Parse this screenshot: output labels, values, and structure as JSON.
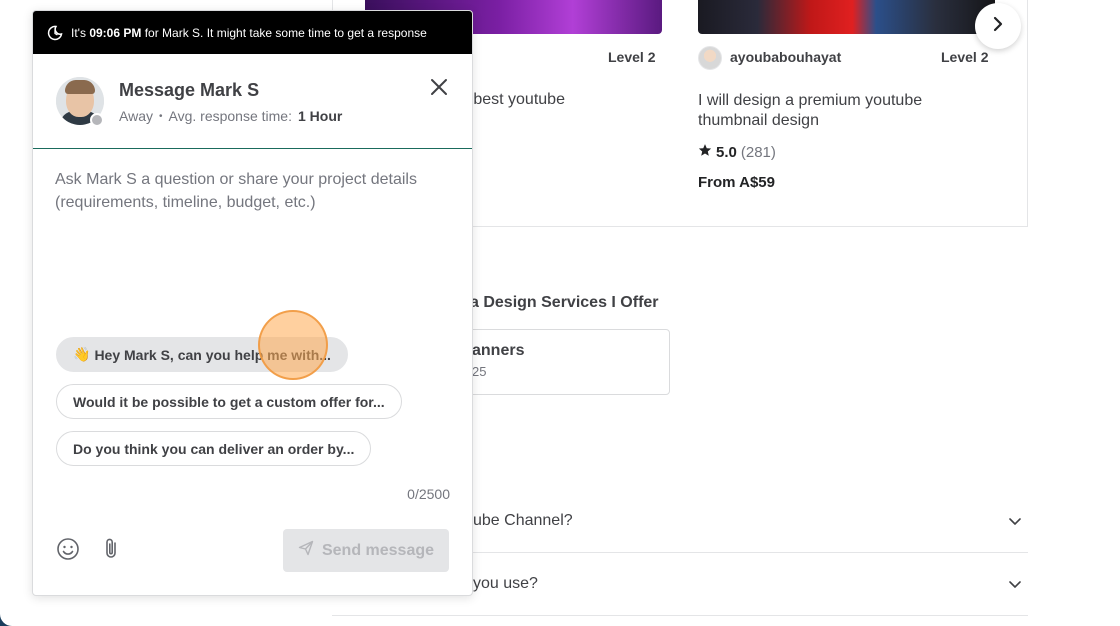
{
  "banner": {
    "prefix": "It's",
    "time": "09:06 PM",
    "suffix": "for Mark S. It might take some time to get a response"
  },
  "chat": {
    "title": "Message Mark S",
    "status": "Away",
    "avg_label": "Avg. response time:",
    "avg_value": "1 Hour",
    "input_placeholder": "Ask Mark S a question or share your project details (requirements, timeline, budget, etc.)",
    "input_value": "",
    "suggestions": [
      {
        "emoji": "👋",
        "label": "Hey Mark S, can you help me with..."
      },
      {
        "label": "Would it be possible to get a custom offer for..."
      },
      {
        "label": "Do you think you can deliver an order by..."
      }
    ],
    "counter": "0/2500",
    "send_label": "Send message"
  },
  "background": {
    "card1": {
      "level": "Level 2",
      "title_fragment": "e best youtube",
      "seller_fragment": ")"
    },
    "card2": {
      "seller": "ayoubabouhayat",
      "level": "Level 2",
      "title": "I will design a premium youtube thumbnail design",
      "rating": "5.0",
      "rating_count": "(281)",
      "price": "From A$59"
    },
    "services_heading": "a Design Services I Offer",
    "service": {
      "name": "anners",
      "sub": "25"
    },
    "faq": [
      {
        "question": "ube Channel?"
      },
      {
        "question": "you use?"
      }
    ]
  },
  "colors": {
    "banner_bg": "#000000",
    "divider_accent": "#1a6b5c",
    "chip_active_bg": "#e4e5e7",
    "send_disabled_bg": "#e4e5e7",
    "send_disabled_text": "#b5b6ba",
    "status_away": "#b5b6ba"
  }
}
